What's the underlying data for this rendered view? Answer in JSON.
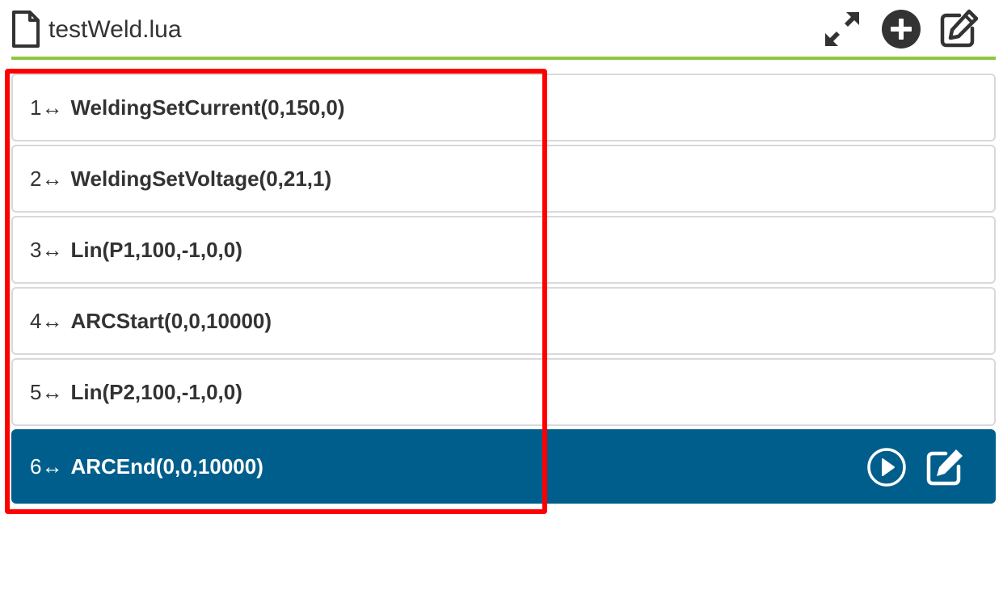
{
  "header": {
    "filename": "testWeld.lua",
    "accent_color": "#8dc63f",
    "icons": {
      "file": "file-icon",
      "expand": "expand-icon",
      "add": "plus-circle-icon",
      "edit": "edit-icon"
    }
  },
  "commands": [
    {
      "number": "1",
      "arrow": "↔",
      "text": "WeldingSetCurrent(0,150,0)"
    },
    {
      "number": "2",
      "arrow": "↔",
      "text": "WeldingSetVoltage(0,21,1)"
    },
    {
      "number": "3",
      "arrow": "↔",
      "text": "Lin(P1,100,-1,0,0)"
    },
    {
      "number": "4",
      "arrow": "↔",
      "text": "ARCStart(0,0,10000)"
    },
    {
      "number": "5",
      "arrow": "↔",
      "text": "Lin(P2,100,-1,0,0)"
    },
    {
      "number": "6",
      "arrow": "↔",
      "text": "ARCEnd(0,0,10000)"
    }
  ],
  "selected_row_color": "#005e8c",
  "highlight_color": "#ff0000",
  "row_icons": {
    "play": "play-circle-icon",
    "edit": "edit-icon"
  }
}
